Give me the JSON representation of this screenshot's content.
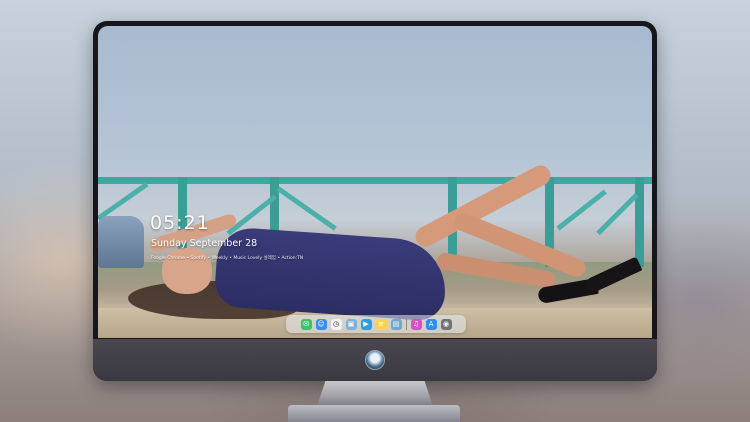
{
  "lock_screen": {
    "time": "05:21",
    "date": "Sunday September  28",
    "subline": "Foogle Chrome  •  Spotify  •  Weekly  •  Music  Lovely  설레임  •  Action:TN"
  },
  "dock": {
    "icons": [
      {
        "name": "messages-icon",
        "glyph": "✉",
        "color": "#3cc46a"
      },
      {
        "name": "finder-icon",
        "glyph": "☺",
        "color": "#3a8df0"
      },
      {
        "name": "clock-icon",
        "glyph": "◷",
        "color": "#f4f4f4"
      },
      {
        "name": "preview-icon",
        "glyph": "▣",
        "color": "#7fb0d8"
      },
      {
        "name": "video-icon",
        "glyph": "▶",
        "color": "#2d9fe0"
      },
      {
        "name": "notes-icon",
        "glyph": "≡",
        "color": "#f7d24a"
      },
      {
        "name": "photos-icon",
        "glyph": "▤",
        "color": "#6fa8c8"
      },
      {
        "name": "music-icon",
        "glyph": "♫",
        "color": "#d84fc8"
      },
      {
        "name": "app-store-icon",
        "glyph": "A",
        "color": "#2f8ef0"
      },
      {
        "name": "camera-icon",
        "glyph": "◉",
        "color": "#707478"
      }
    ]
  },
  "colors": {
    "fence": "#3fa6a0",
    "dress": "#2e3068",
    "monitor_bezel": "#17161a",
    "monitor_chin": "#423f47"
  }
}
